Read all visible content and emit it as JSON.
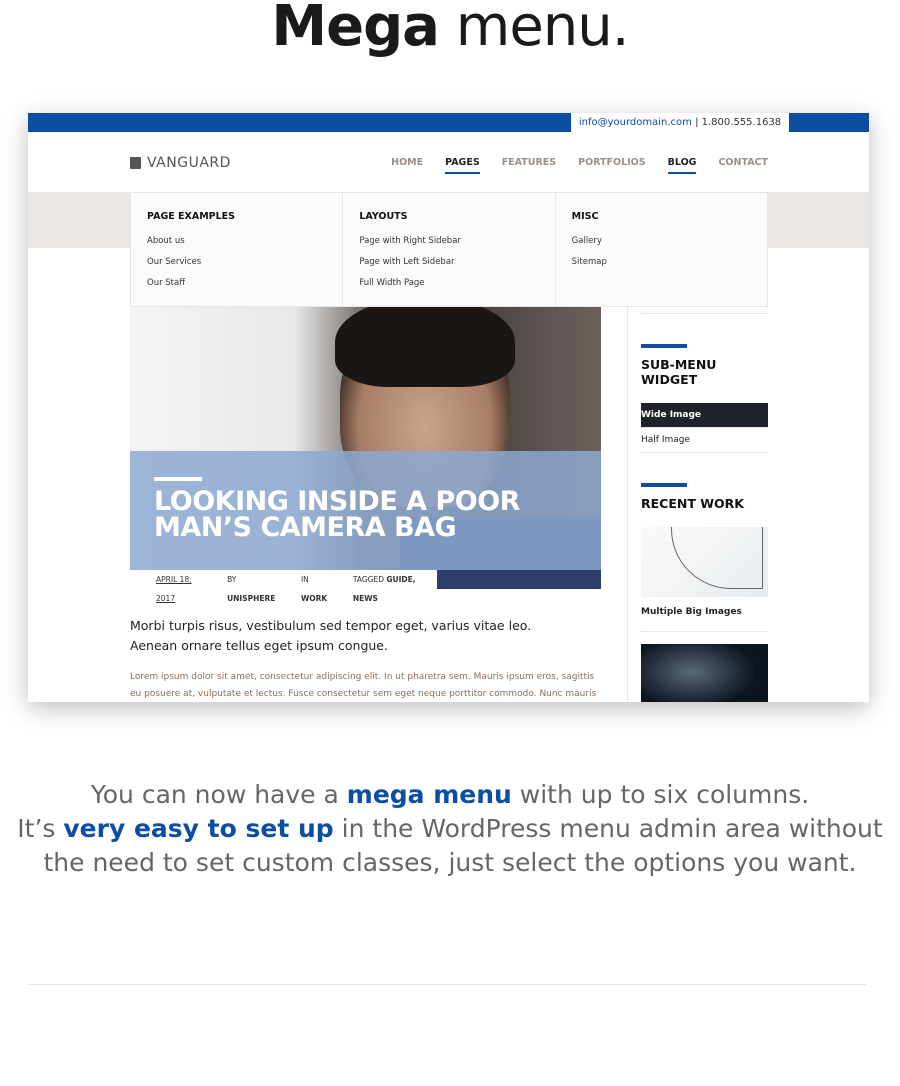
{
  "headline": {
    "bold": "Mega",
    "rest": "menu."
  },
  "site": {
    "email": "info@yourdomain.com",
    "separator": "|",
    "phone": "1.800.555.1638",
    "logo": "VANGUARD",
    "nav": [
      {
        "label": "HOME"
      },
      {
        "label": "PAGES",
        "active": true
      },
      {
        "label": "FEATURES"
      },
      {
        "label": "PORTFOLIOS"
      },
      {
        "label": "BLOG",
        "active": true
      },
      {
        "label": "CONTACT"
      }
    ],
    "mega_menu": [
      {
        "heading": "PAGE EXAMPLES",
        "items": [
          "About us",
          "Our Services",
          "Our Staff"
        ]
      },
      {
        "heading": "LAYOUTS",
        "items": [
          "Page with Right Sidebar",
          "Page with Left Sidebar",
          "Full Width Page"
        ]
      },
      {
        "heading": "MISC",
        "items": [
          "Gallery",
          "Sitemap"
        ]
      }
    ],
    "post": {
      "title": "LOOKING INSIDE A POOR MAN’S CAMERA BAG",
      "date": "APRIL 18, 2017",
      "by": "BY",
      "author": "UNISPHERE",
      "in": "IN",
      "category": "WORK",
      "tagged": "TAGGED",
      "tags": "GUIDE, NEWS",
      "lead": "Morbi turpis risus, vestibulum sed tempor eget, varius vitae leo. Aenean ornare tellus eget ipsum congue.",
      "body": "Lorem ipsum dolor sit amet, consectetur adipiscing elit. In ut pharetra sem. Mauris ipsum eros, sagittis eu posuere at, vulputate et lectus. Fusce consectetur sem eget neque porttitor commodo. Nunc mauris velit,"
    },
    "sidebar": {
      "submenu_title": "SUB-MENU WIDGET",
      "submenu_items": [
        "Wide Image",
        "Half Image"
      ],
      "recent_title": "RECENT WORK",
      "recent_caption": "Multiple Big Images"
    }
  },
  "description": {
    "l1a": "You can now have a ",
    "l1b": "mega menu",
    "l1c": " with up to six columns.",
    "l2a": "It’s ",
    "l2b": "very easy to set up",
    "l2c": " in the WordPress menu admin area without",
    "l3": "the need to set custom classes, just select the options you want."
  },
  "colors": {
    "accent": "#0b4ea2",
    "text_gray": "#666666"
  }
}
